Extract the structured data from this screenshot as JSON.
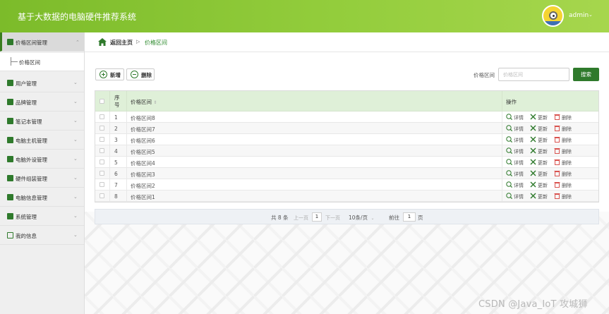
{
  "header": {
    "title": "基于大数据的电脑硬件推荐系统",
    "username": "admin",
    "caret": "⌄"
  },
  "sidebar": {
    "items": [
      {
        "label": "价格区间管理",
        "icon": "price-icon",
        "active": true
      },
      {
        "label": "用户管理",
        "icon": "user-icon"
      },
      {
        "label": "品牌管理",
        "icon": "brand-icon"
      },
      {
        "label": "笔记本管理",
        "icon": "laptop-icon"
      },
      {
        "label": "电脑主机管理",
        "icon": "host-icon"
      },
      {
        "label": "电脑外设管理",
        "icon": "peripheral-icon"
      },
      {
        "label": "硬件组装管理",
        "icon": "assembly-icon"
      },
      {
        "label": "电脑信息管理",
        "icon": "info-icon"
      },
      {
        "label": "系统管理",
        "icon": "system-icon"
      },
      {
        "label": "我的信息",
        "icon": "profile-icon"
      }
    ],
    "sub_item": "价格区间",
    "arrow": "⌄"
  },
  "breadcrumb": {
    "home": "返回主页",
    "separator": "▷",
    "current": "价格区间"
  },
  "toolbar": {
    "add_label": "新增",
    "delete_label": "删除",
    "search_label": "价格区间",
    "search_placeholder": "价格区间",
    "search_button": "搜索"
  },
  "table": {
    "columns": {
      "index": "序号",
      "name": "价格区间",
      "sort": "⇕",
      "ops": "操作"
    },
    "ops": {
      "detail": "详情",
      "update": "更新",
      "delete": "删除"
    },
    "rows": [
      {
        "index": "1",
        "name": "价格区间8"
      },
      {
        "index": "2",
        "name": "价格区间7"
      },
      {
        "index": "3",
        "name": "价格区间6"
      },
      {
        "index": "4",
        "name": "价格区间5"
      },
      {
        "index": "5",
        "name": "价格区间4"
      },
      {
        "index": "6",
        "name": "价格区间3"
      },
      {
        "index": "7",
        "name": "价格区间2"
      },
      {
        "index": "8",
        "name": "价格区间1"
      }
    ]
  },
  "pagination": {
    "total": "共 8 条",
    "prev": "上一页",
    "page": "1",
    "next": "下一页",
    "page_size": "10条/页",
    "page_size_caret": "⌄",
    "goto": "前往",
    "goto_value": "1",
    "page_unit": "页"
  },
  "watermark": "CSDN @Java_IoT 攻城狮",
  "colors": {
    "accent": "#2f7a2c",
    "header": "#8dc63f",
    "table_head": "#dff0d8"
  }
}
